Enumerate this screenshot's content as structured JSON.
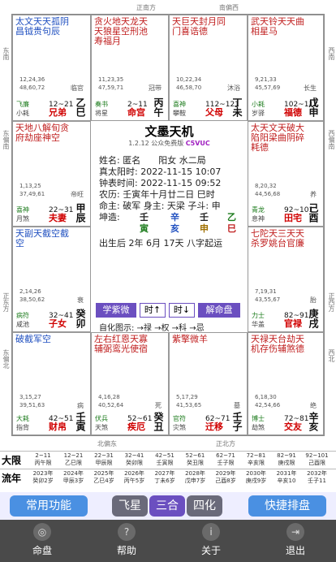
{
  "directions": {
    "top_left": "正南方",
    "top_right": "南偏西",
    "bottom_left": "北偏东",
    "bottom_right": "正北方",
    "left_top": "东南",
    "left_mid": "东偏南",
    "left_bot": "正东方",
    "left_bot2": "东偏北",
    "right_top": "西南",
    "right_mid": "西偏南",
    "right_mid2": "正西方",
    "right_bot": "西北"
  },
  "cells": [
    {
      "stars": "太文天天孤阴昌钺贵句辰",
      "sub": "陷庙平旺",
      "nums": "12,24,36\n48,60,72",
      "stage": "临官",
      "bl1": "飞廉",
      "bl2": "小耗",
      "rng": "12~21",
      "pal": "兄弟",
      "gz": "乙巳"
    },
    {
      "stars": "贪火地天龙天天狼星空刑池寿福月",
      "sub": "旺得陷平",
      "nums": "11,23,35\n47,59,71",
      "stage": "冠带",
      "bl1": "奏书",
      "bl2": "将星",
      "rng": "2~11",
      "pal": "命宫",
      "gz": "丙午"
    },
    {
      "stars": "天巨天封月同门喜诰德",
      "sub": "庙旺旺",
      "nums": "10,22,34\n46,58,70",
      "stage": "沐浴",
      "bl1": "喜神",
      "bl2": "攀鞍",
      "rng": "112~121",
      "pal": "父母",
      "gz": "丁未"
    },
    {
      "stars": "武天铃天天曲相星马",
      "sub": "得庙旺",
      "nums": "9,21,33\n45,57,69",
      "stage": "长生",
      "bl1": "小耗",
      "bl2": "岁驿",
      "rng": "102~111",
      "pal": "福德",
      "gz": "戊申"
    },
    {
      "stars": "天地八解旬贪府劫座神空",
      "sub": "庙旺平",
      "nums": "1,13,25\n37,49,61",
      "stage": "帝旺",
      "bl1": "喜神",
      "bl2": "月煞",
      "rng": "22~31",
      "pal": "夫妻",
      "gz": "甲辰"
    },
    {
      "stars": "太天文天破大陷阳梁曲阴碎耗德",
      "sub": "平庙得",
      "nums": "8,20,32\n44,56,68",
      "stage": "养",
      "bl1": "青龙",
      "bl2": "息神",
      "rng": "92~101",
      "pal": "田宅",
      "gz": "己酉"
    },
    {
      "stars": "天副天截空截空",
      "sub": "旺平",
      "nums": "2,14,26\n38,50,62",
      "stage": "衰",
      "bl1": "病符",
      "bl2": "咸池",
      "rng": "32~41",
      "pal": "子女",
      "gz": "癸卯"
    },
    {
      "stars": "七陀天三天天杀罗姚台官廉",
      "sub": "庙庙",
      "nums": "7,19,31\n43,55,67",
      "stage": "胎",
      "bl1": "力士",
      "bl2": "华盖",
      "rng": "82~91",
      "pal": "官禄",
      "gz": "庚戌"
    },
    {
      "stars": "破截军空",
      "sub": "旺",
      "nums": "3,15,27\n39,51,63",
      "stage": "病",
      "bl1": "大耗",
      "bl2": "指背",
      "rng": "42~51",
      "pal": "财帛",
      "gz": "壬寅"
    },
    {
      "stars": "左右红恩天寡辅弼鸾光使宿",
      "sub": "庙",
      "nums": "4,16,28\n40,52,64",
      "stage": "死",
      "bl1": "伏兵",
      "bl2": "天煞",
      "rng": "52~61",
      "pal": "疾厄",
      "gz": "癸丑"
    },
    {
      "stars": "紫擎微羊",
      "sub": "平",
      "nums": "5,17,29\n41,53,65",
      "stage": "墓",
      "bl1": "官符",
      "bl2": "灾煞",
      "rng": "62~71",
      "pal": "迁移",
      "gz": "壬子"
    },
    {
      "stars": "天禄天台劫天机存伤辅煞德",
      "sub": "平庙",
      "nums": "6,18,30\n42,54,66",
      "stage": "绝",
      "bl1": "博士",
      "bl2": "劫煞",
      "rng": "72~81",
      "pal": "交友",
      "gz": "辛亥"
    }
  ],
  "center": {
    "title": "文墨天机",
    "version": "1.2.12 公众免费版",
    "version_tag": "C5VUC",
    "name": "姓名: 匿名　　阳女 水二局",
    "true_solar": "真太阳时: 2022-11-15 10:07",
    "clock": "钟表时间: 2022-11-15 09:52",
    "lunar": "农历: 壬寅年十月廿二日 巳时",
    "fate": "命主: 破军 身主: 天梁 子斗: 申",
    "kun": "坤造:",
    "pillars": [
      "壬",
      "辛",
      "壬",
      "乙"
    ],
    "branches": [
      "寅",
      "亥",
      "申",
      "巳"
    ],
    "born": "出生后 2年 6月 17天 八字起运",
    "btn_xuezi": "学紫微",
    "btn_time_up": "时↑",
    "btn_time_down": "时↓",
    "btn_jiemingpan": "解命盘",
    "legend": "自化图示: →禄 →权 →科 →忌"
  },
  "dayun": {
    "label": "大限",
    "cells": [
      [
        "2~11",
        "丙午限"
      ],
      [
        "12~21",
        "乙巳限"
      ],
      [
        "22~31",
        "甲辰限"
      ],
      [
        "32~41",
        "癸卯限"
      ],
      [
        "42~51",
        "壬寅限"
      ],
      [
        "52~61",
        "癸丑限"
      ],
      [
        "62~71",
        "壬子限"
      ],
      [
        "72~81",
        "辛亥限"
      ],
      [
        "82~91",
        "庚戌限"
      ],
      [
        "92~101",
        "己酉限"
      ]
    ]
  },
  "liunian": {
    "label": "流年",
    "cells": [
      [
        "2023年",
        "癸卯2岁"
      ],
      [
        "2024年",
        "甲辰3岁"
      ],
      [
        "2025年",
        "乙巳4岁"
      ],
      [
        "2026年",
        "丙午5岁"
      ],
      [
        "2027年",
        "丁未6岁"
      ],
      [
        "2028年",
        "戊申7岁"
      ],
      [
        "2029年",
        "己酉8岁"
      ],
      [
        "2030年",
        "庚戌9岁"
      ],
      [
        "2031年",
        "辛亥10"
      ],
      [
        "2032年",
        "壬子11"
      ]
    ]
  },
  "buttons": {
    "common": "常用功能",
    "fly": "飞星",
    "sanhe": "三合",
    "sihua": "四化",
    "quick": "快捷排盘"
  },
  "tabs": [
    {
      "label": "命盘",
      "icon": "◎"
    },
    {
      "label": "帮助",
      "icon": "?"
    },
    {
      "label": "关于",
      "icon": "i"
    },
    {
      "label": "退出",
      "icon": "⇥"
    }
  ]
}
